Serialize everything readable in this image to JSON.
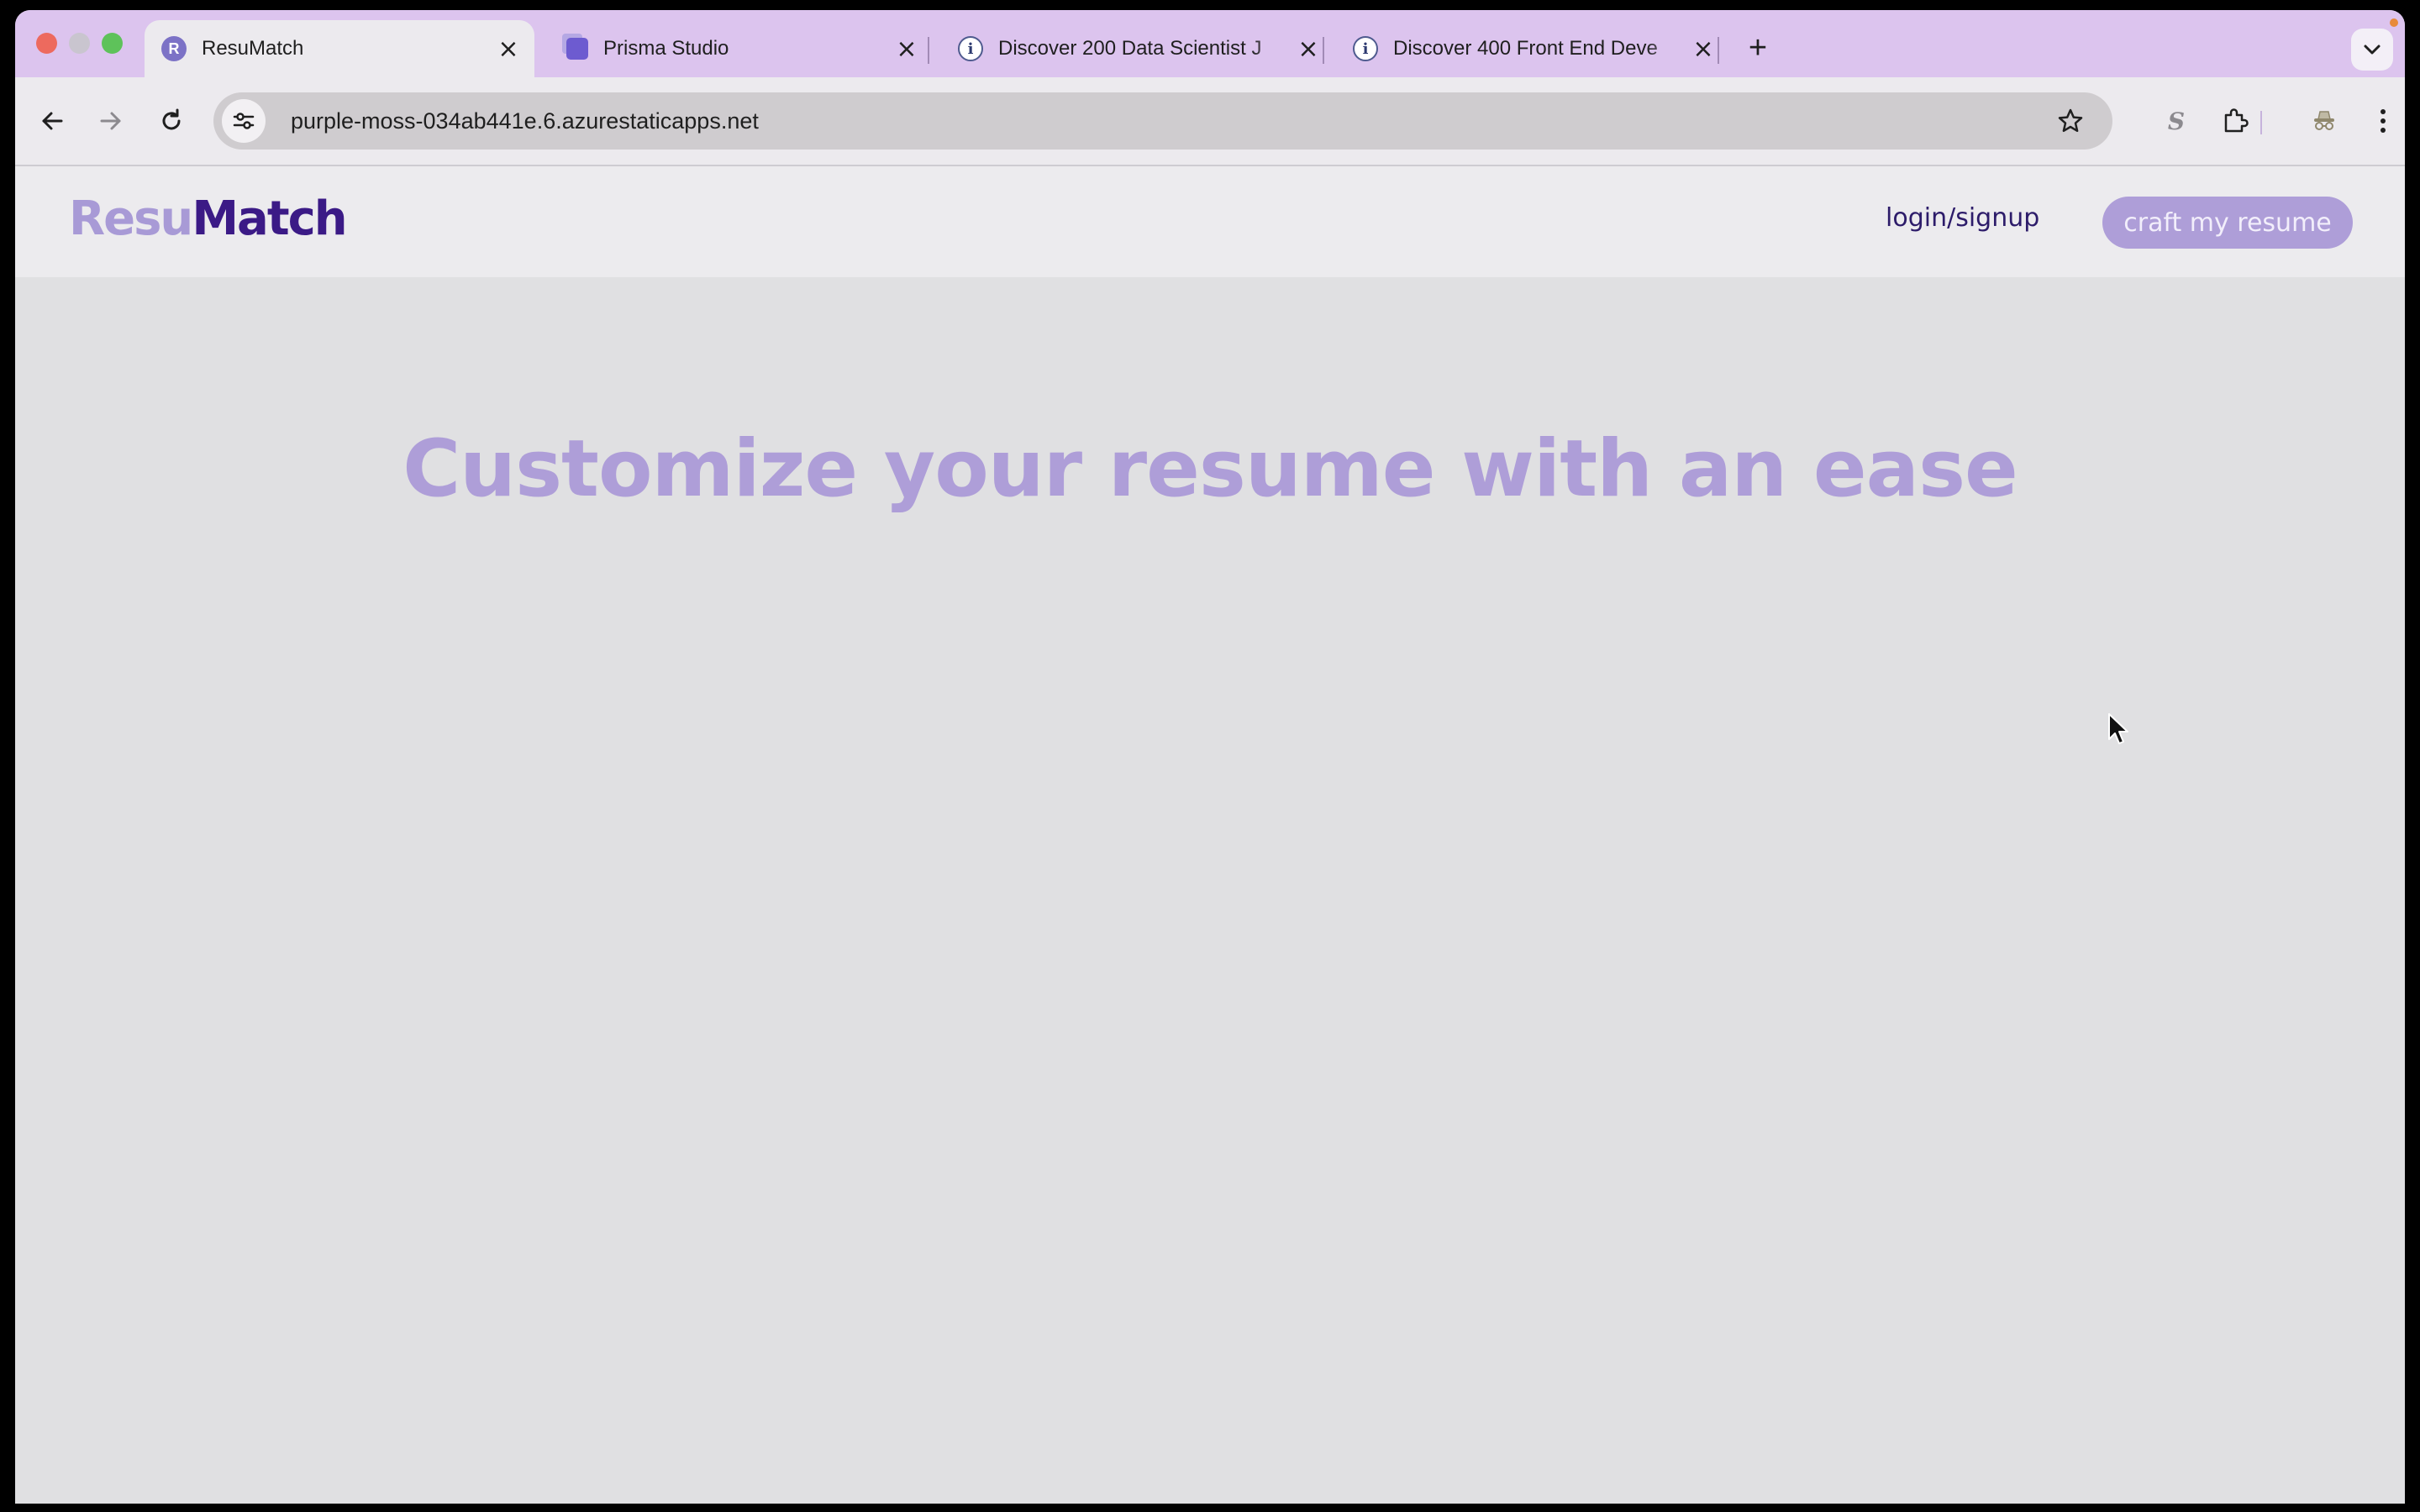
{
  "browser": {
    "tabs": [
      {
        "title": "ResuMatch",
        "favicon": "R",
        "active": true
      },
      {
        "title": "Prisma Studio",
        "favicon": "prisma-icon",
        "active": false
      },
      {
        "title": "Discover 200 Data Scientist J",
        "favicon": "info-icon",
        "active": false
      },
      {
        "title": "Discover 400 Front End Deve",
        "favicon": "info-icon",
        "active": false
      }
    ],
    "url": "purple-moss-034ab441e.6.azurestaticapps.net",
    "extension_s": "S"
  },
  "site": {
    "logo_part1": "Resu",
    "logo_part2": "Match",
    "login_label": "login/signup",
    "cta_label": "craft my resume",
    "hero_text": "Customize your resume with an ease"
  },
  "colors": {
    "accent_light": "#ae9ed8",
    "brand_dark": "#3b1a86",
    "tabstrip": "#dcc4ee"
  }
}
